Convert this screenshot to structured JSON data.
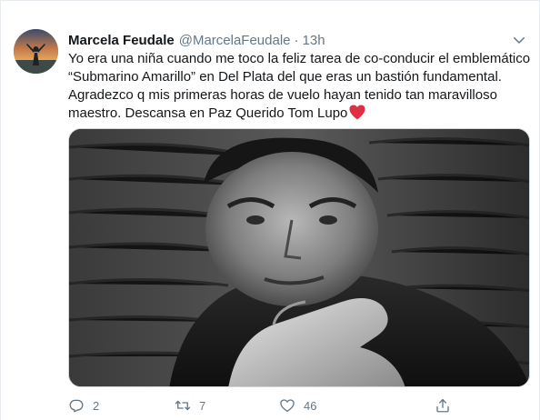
{
  "tweet": {
    "display_name": "Marcela Feudale",
    "handle": "@MarcelaFeudale",
    "separator": "·",
    "time": "13h",
    "text_lines": [
      "Yo era una niña cuando me toco la feliz tarea de co-conducir el emblemático",
      "“Submarino Amarillo” en Del Plata del que eras un bastión fundamental.",
      "Agradezco q mis primeras horas de vuelo hayan tenido tan maravilloso",
      "maestro. Descansa en Paz Querido Tom Lupo"
    ],
    "inline_emoji": "red-heart",
    "accent_color": "#1da1f2",
    "heart_color": "#dd2e44"
  },
  "actions": {
    "reply_count": "2",
    "retweet_count": "7",
    "like_count": "46",
    "reply_icon": "reply-icon",
    "retweet_icon": "retweet-icon",
    "like_icon": "heart-outline-icon",
    "share_icon": "share-icon"
  }
}
